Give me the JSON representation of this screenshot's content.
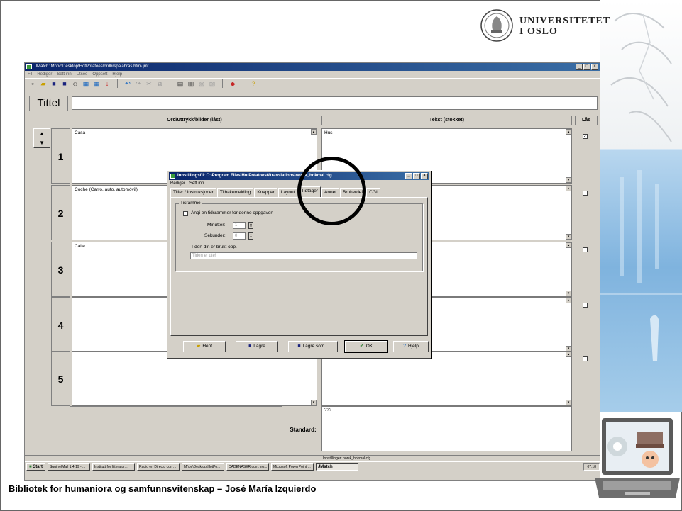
{
  "logo": {
    "line1": "UNIVERSITETET",
    "line2": "I OSLO"
  },
  "app": {
    "title": "JMatch: M:\\pc\\Desktop\\HotPotatoes\\ordbrspalabras.htm\\.jmt",
    "menu": [
      "Fil",
      "Rediger",
      "Sett inn",
      "Utsee",
      "Oppsett",
      "Hjelp"
    ],
    "window_buttons": [
      "_",
      "□",
      "×"
    ],
    "toolbar_icons": [
      "new-icon",
      "open-icon",
      "save-icon",
      "save-as-icon",
      "eraser-icon",
      "web-page-icon",
      "export-icon",
      "insert-icon",
      "undo-icon",
      "redo-icon",
      "cut-icon",
      "copy-icon",
      "paste-icon",
      "table-icon",
      "config-icon",
      "help-icon"
    ],
    "tittel_label": "Tittel",
    "tittel_value": "",
    "columns": {
      "left": "Ord/uttrykk/bilder (låst)",
      "right": "Tekst (stokket)",
      "lock": "Lås"
    },
    "rows": [
      {
        "num": "1",
        "left": "Casa",
        "right": "Hus",
        "locked": "✓"
      },
      {
        "num": "2",
        "left": "Coche (Carro, auto, automóvil)",
        "right": "",
        "locked": ""
      },
      {
        "num": "3",
        "left": "Calle",
        "right": "",
        "locked": ""
      },
      {
        "num": "4",
        "left": "",
        "right": "",
        "locked": ""
      },
      {
        "num": "5",
        "left": "",
        "right": "",
        "locked": ""
      }
    ],
    "standard_label": "Standard:",
    "standard_value": "???",
    "status_text": "Innstillinger: norsk_bokmal.cfg"
  },
  "taskbar": {
    "start": "Start",
    "items": [
      "SquirrelMail 1.4.19 - ...",
      "Institutt for litteratur...",
      "Radio en Directo con ...",
      "M:\\pc\\Desktop\\HotPo...",
      "CADENASER.com: no...",
      "Microsoft PowerPoint ...",
      "JMatch"
    ],
    "clock": "07:18"
  },
  "dialog": {
    "title": "Innstillingsfil: C:\\Program Files\\HotPotatoes6\\translations\\norsk_bokmal.cfg",
    "menu": [
      "Rediger",
      "Sett inn"
    ],
    "tabs": [
      "Titler / Instruksjoner",
      "Tilbakemelding",
      "Knapper",
      "Layout",
      "Tidtager",
      "Annet",
      "Brukerdef",
      "CGI"
    ],
    "active_tab": "Tidtager",
    "group_label": "Tisramme",
    "checkbox_label": "Angi en tidsrammer for denne oppgaven",
    "minutes_label": "Minutter:",
    "minutes_value": "1",
    "seconds_label": "Sekunder:",
    "seconds_value": "0",
    "time_up_label": "Tiden din er brukt opp.",
    "time_up_value": "Tiden er ute!",
    "buttons": {
      "load": "Hent",
      "save": "Lagre",
      "save_as": "Lagre som...",
      "ok": "OK",
      "help": "Hjelp"
    }
  },
  "footer": "Bibliotek for humaniora og samfunnsvitenskap – José María Izquierdo"
}
